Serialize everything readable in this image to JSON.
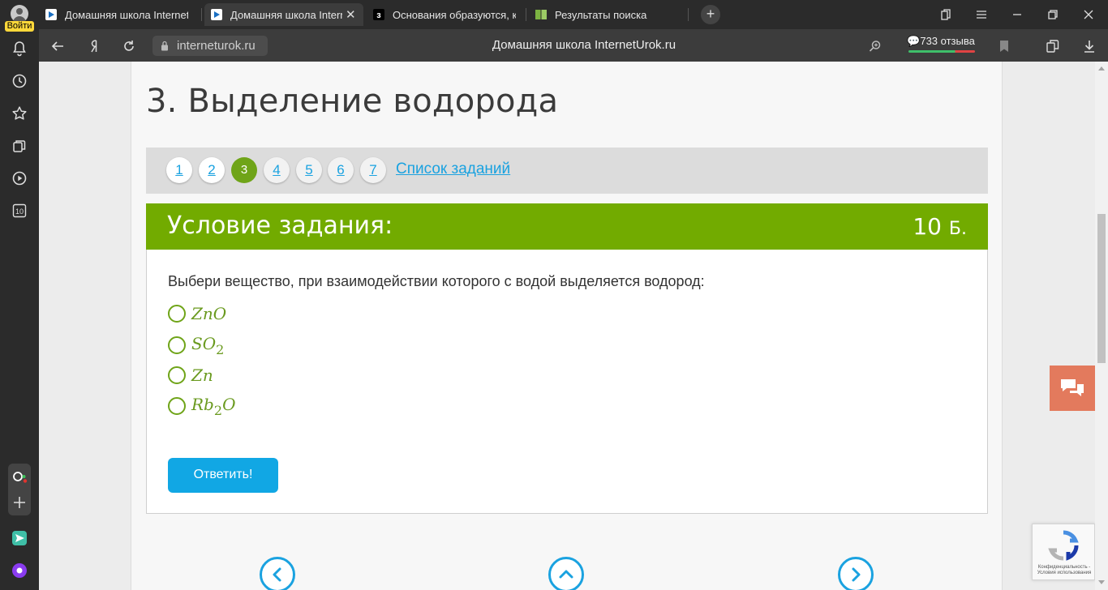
{
  "browser": {
    "login_label": "Войти",
    "tabs": [
      {
        "title": "Домашняя школа InternetUrok.ru",
        "icon": "internetUrok-favicon",
        "active": false
      },
      {
        "title": "Домашняя школа InternetUrok.ru",
        "icon": "internetUrok-favicon",
        "active": true
      },
      {
        "title": "Основания образуются, как",
        "icon": "znanija-favicon",
        "active": false
      },
      {
        "title": "Результаты поиска",
        "icon": "book-favicon",
        "active": false
      }
    ],
    "close_glyph": "✕",
    "newtab_glyph": "+",
    "url": "interneturok.ru",
    "page_title": "Домашняя школа InternetUrok.ru",
    "reviews": "733 отзыва",
    "sidebar_badge": "10",
    "colors": {
      "chrome": "#2b2b2b",
      "addrbar": "#3c3c3c",
      "login_badge": "#ffd83a"
    }
  },
  "lesson": {
    "title": "3. Выделение водорода",
    "pager": {
      "pages": [
        "1",
        "2",
        "3",
        "4",
        "5",
        "6",
        "7"
      ],
      "current": "3",
      "list_link": "Список заданий"
    },
    "task": {
      "header": "Условие задания:",
      "points_value": "10",
      "points_unit": "Б.",
      "question": "Выбери вещество, при взаимодействии которого с водой выделяется водород:",
      "options": [
        {
          "base": "ZnO",
          "sub": "",
          "rest": ""
        },
        {
          "base": "SO",
          "sub": "2",
          "rest": ""
        },
        {
          "base": "Zn",
          "sub": "",
          "rest": ""
        },
        {
          "base": "Rb",
          "sub": "2",
          "rest": "O"
        }
      ],
      "submit_label": "Ответить!"
    },
    "nav_icons": [
      "prev-arrow-icon",
      "up-arrow-icon",
      "next-arrow-icon"
    ],
    "recaptcha_text": "Конфиденциальность - Условия использования",
    "colors": {
      "accent_green": "#72ab00",
      "link_blue": "#1aa2e0",
      "submit_blue": "#11a7e4",
      "chat": "#e37a5d"
    }
  }
}
